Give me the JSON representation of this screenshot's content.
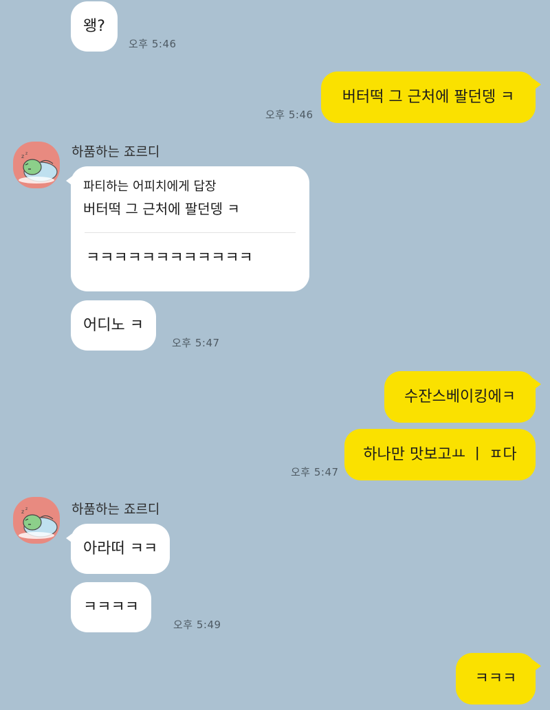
{
  "sender_name": "하품하는 죠르디",
  "avatar_icon": "sleeping-jordy-avatar-icon",
  "colors": {
    "background": "#abc1d1",
    "my_bubble": "#fae100",
    "their_bubble": "#ffffff",
    "avatar_bg": "#e88a80"
  },
  "messages": {
    "m1": {
      "text": "왱?",
      "time": "오후 5:46"
    },
    "m2": {
      "text": "버터떡 그 근처에 팔던뎅 ㅋ",
      "time": "오후 5:46"
    },
    "m3": {
      "reply_header": "파티하는 어피치에게 답장",
      "quoted": "버터떡 그 근처에 팔던뎅 ㅋ",
      "text": "ㅋㅋㅋㅋㅋㅋㅋㅋㅋㅋㅋㅋ"
    },
    "m4": {
      "text": "어디노 ㅋ",
      "time": "오후 5:47"
    },
    "m5": {
      "text": "수잔스베이킹에ㅋ"
    },
    "m6": {
      "text": "하나만 맛보고ㅛ ㅣ ㅍ다",
      "time": "오후 5:47"
    },
    "m7": {
      "text": "아라떠 ㅋㅋ"
    },
    "m8": {
      "text": "ㅋㅋㅋㅋ",
      "time": "오후 5:49"
    },
    "m9": {
      "text": "ㅋㅋㅋ"
    }
  }
}
